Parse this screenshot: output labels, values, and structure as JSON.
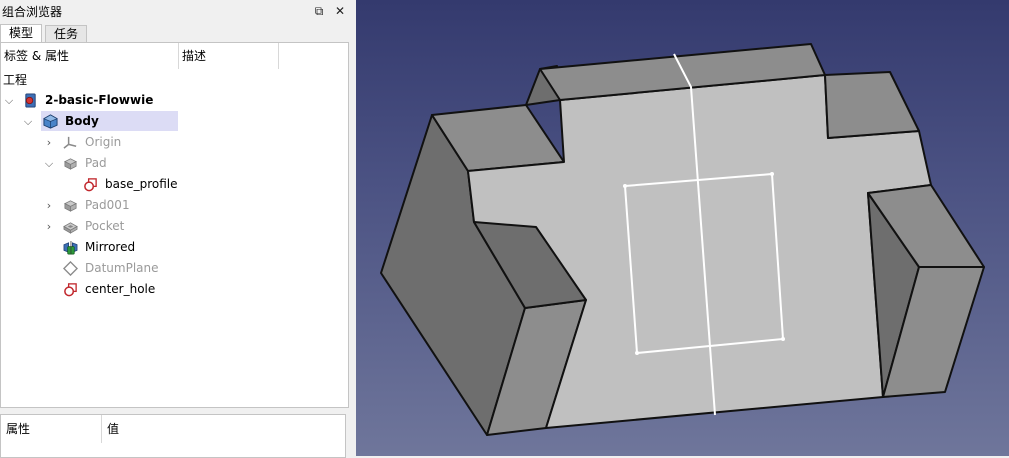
{
  "combo": {
    "title": "组合浏览器",
    "float_glyph": "⧉",
    "close_glyph": "✕",
    "tabs": [
      {
        "label": "模型",
        "active": true
      },
      {
        "label": "任务",
        "active": false
      }
    ],
    "tree_headers": {
      "label": "标签 & 属性",
      "description": "描述"
    },
    "root_label": "工程",
    "items": [
      {
        "label": "2-basic-Flowwie",
        "icon": "document-icon",
        "expanded": true,
        "bold": true
      },
      {
        "label": "Body",
        "icon": "body-icon",
        "expanded": true,
        "bold": true,
        "selected": true
      },
      {
        "label": "Origin",
        "icon": "origin-icon",
        "expanded": false,
        "greyed": true
      },
      {
        "label": "Pad",
        "icon": "pad-icon",
        "expanded": true,
        "greyed": true
      },
      {
        "label": "base_profile",
        "icon": "sketch-icon"
      },
      {
        "label": "Pad001",
        "icon": "pad-icon",
        "expanded": false,
        "greyed": true
      },
      {
        "label": "Pocket",
        "icon": "pocket-icon",
        "expanded": false,
        "greyed": true
      },
      {
        "label": "Mirrored",
        "icon": "mirrored-icon"
      },
      {
        "label": "DatumPlane",
        "icon": "datum-plane-icon",
        "greyed": true
      },
      {
        "label": "center_hole",
        "icon": "sketch-icon"
      }
    ],
    "property_headers": {
      "name": "属性",
      "value": "值"
    }
  },
  "colors": {
    "selection": "#dcdcf5",
    "viewport_top": "#343a6e",
    "viewport_bottom": "#6f769b",
    "face_light": "#c0c0c0",
    "face_top": "#8d8d8d",
    "face_side": "#6e6e6e",
    "sketch_accent": "#c1272d"
  }
}
